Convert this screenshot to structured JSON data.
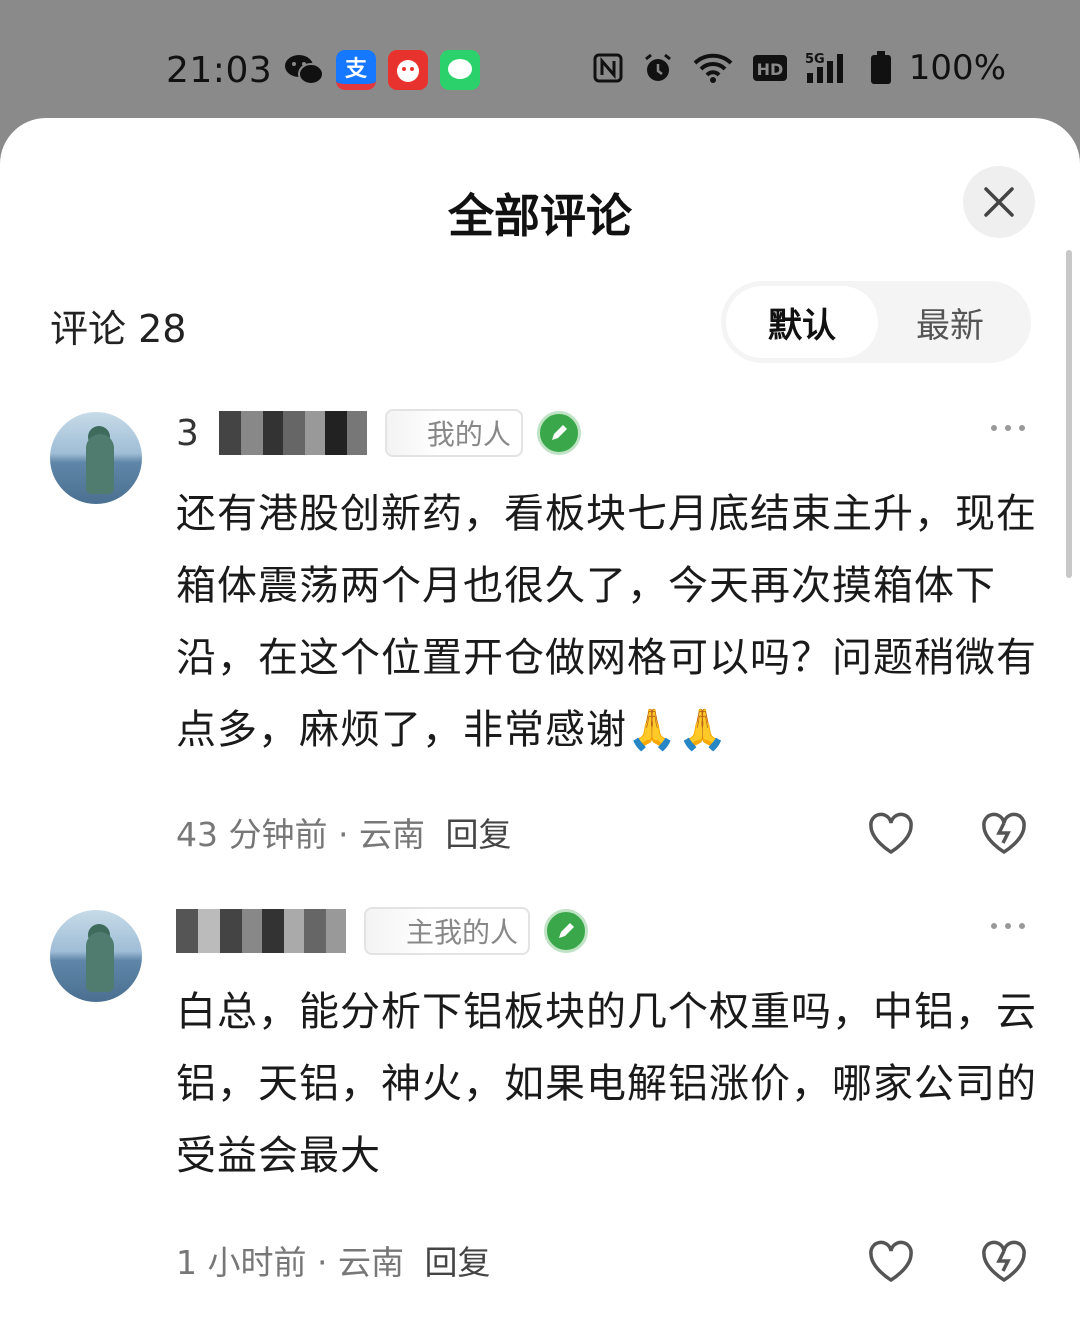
{
  "status_bar": {
    "time": "21:03",
    "battery": "100%",
    "hd_label": "HD",
    "network_label": "5G",
    "apps": [
      "wechat-icon",
      "alipay-icon",
      "eleme-icon",
      "messages-icon"
    ]
  },
  "sheet": {
    "title": "全部评论",
    "comment_count_label": "评论 28",
    "sort": {
      "default_label": "默认",
      "latest_label": "最新",
      "active": "默认"
    }
  },
  "comments": [
    {
      "name_visible": "3",
      "tag": "我的人",
      "text": "还有港股创新药，看板块七月底结束主升，现在箱体震荡两个月也很久了，今天再次摸箱体下沿，在这个位置开仓做网格可以吗？问题稍微有点多，麻烦了，非常感谢🙏🙏",
      "time": "43 分钟前",
      "location": "云南",
      "reply_label": "回复"
    },
    {
      "name_visible": "",
      "tag": "主我的人",
      "text": "白总，能分析下铝板块的几个权重吗，中铝，云铝，天铝，神火，如果电解铝涨价，哪家公司的受益会最大",
      "time": "1 小时前",
      "location": "云南",
      "reply_label": "回复"
    }
  ],
  "meta_separator": " · ",
  "colors": {
    "sheet_bg": "#ffffff",
    "backdrop": "#8a8a8a",
    "badge_green": "#3aa84a"
  }
}
